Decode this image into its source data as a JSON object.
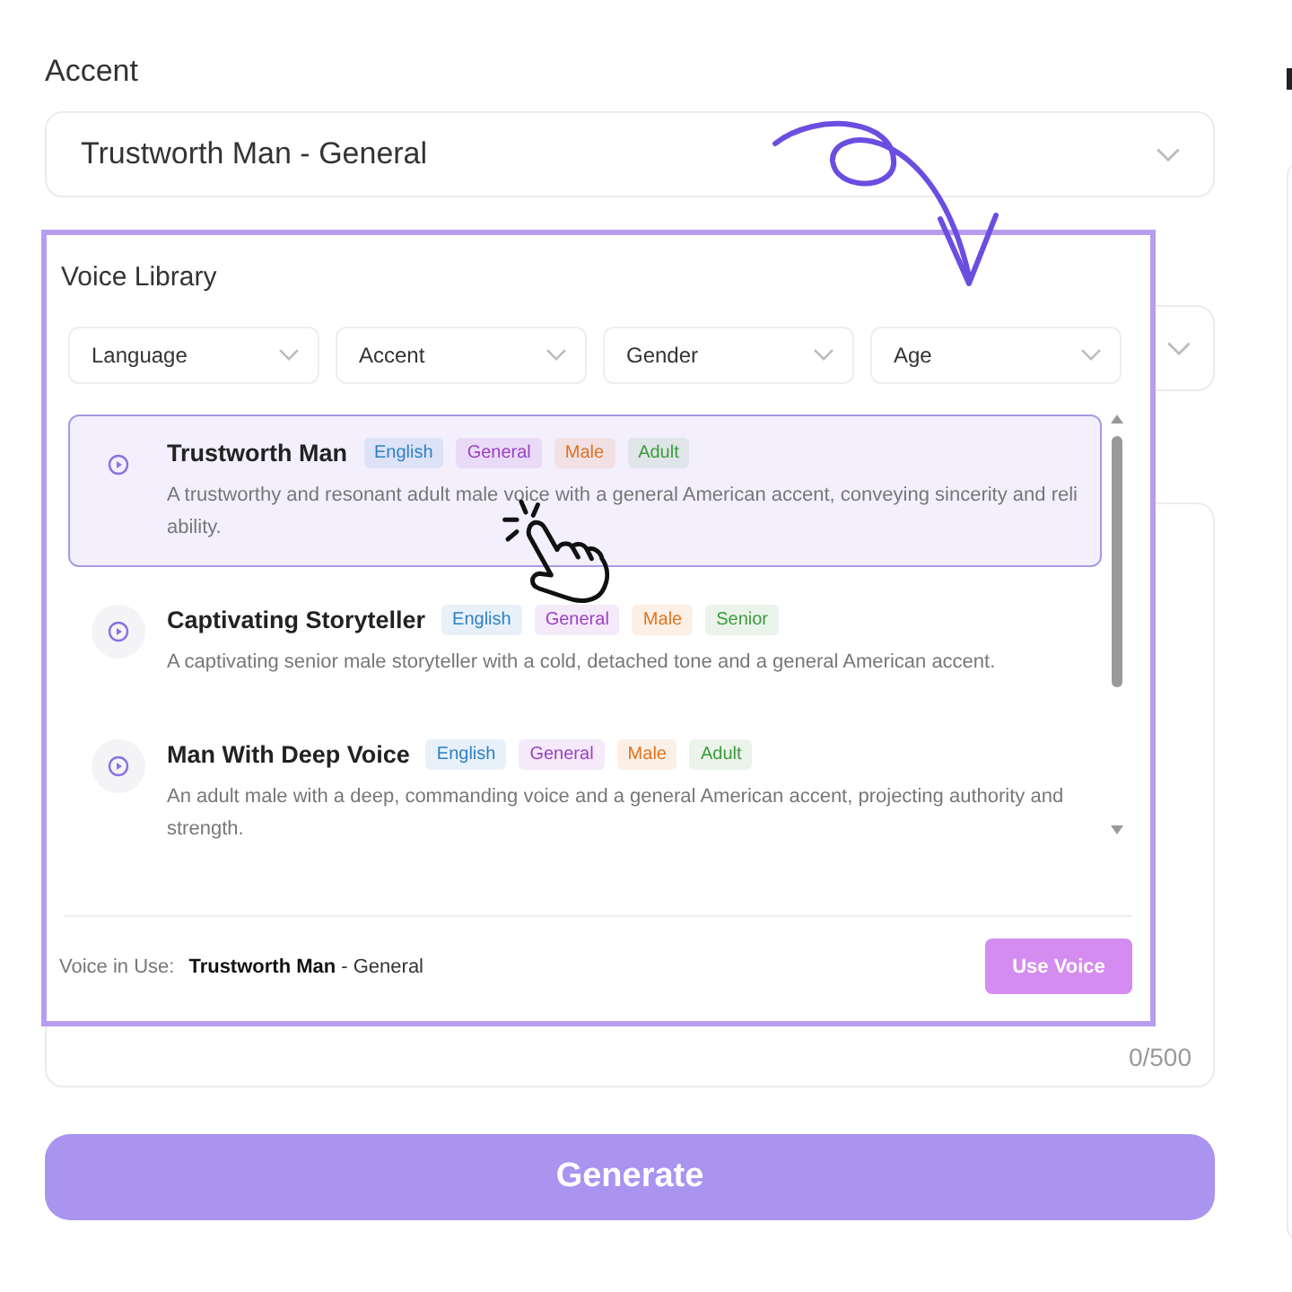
{
  "accent": {
    "label": "Accent",
    "value": "Trustworth Man - General"
  },
  "voice_library": {
    "title": "Voice Library",
    "filters": [
      {
        "label": "Language"
      },
      {
        "label": "Accent"
      },
      {
        "label": "Gender"
      },
      {
        "label": "Age"
      }
    ],
    "voices": [
      {
        "name": "Trustworth Man",
        "selected": true,
        "tags": [
          {
            "label": "English",
            "color": "#2f80c4"
          },
          {
            "label": "General",
            "color": "#9a3fc4"
          },
          {
            "label": "Male",
            "color": "#e0731f"
          },
          {
            "label": "Adult",
            "color": "#3c9a3c"
          }
        ],
        "description": "A trustworthy and resonant adult male voice with a general American accent, conveying sincerity and reliability."
      },
      {
        "name": "Captivating Storyteller",
        "selected": false,
        "tags": [
          {
            "label": "English",
            "color": "#2f80c4"
          },
          {
            "label": "General",
            "color": "#9a3fc4"
          },
          {
            "label": "Male",
            "color": "#e0731f"
          },
          {
            "label": "Senior",
            "color": "#3c9a3c"
          }
        ],
        "description": "A captivating senior male storyteller with a cold, detached tone and a general American accent."
      },
      {
        "name": "Man With Deep Voice",
        "selected": false,
        "tags": [
          {
            "label": "English",
            "color": "#2f80c4"
          },
          {
            "label": "General",
            "color": "#9a3fc4"
          },
          {
            "label": "Male",
            "color": "#e0731f"
          },
          {
            "label": "Adult",
            "color": "#3c9a3c"
          }
        ],
        "description": "An adult male with a deep, commanding voice and a general American accent, projecting authority and strength."
      }
    ],
    "footer": {
      "label": "Voice in Use:",
      "value": "**Trustworth Man** - General",
      "button": "Use Voice"
    }
  },
  "text_area": {
    "counter": "0/500"
  },
  "generate_button": "Generate"
}
